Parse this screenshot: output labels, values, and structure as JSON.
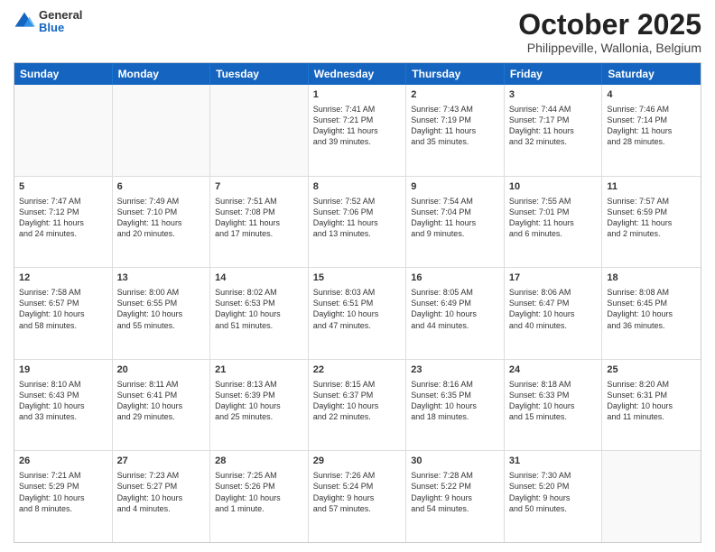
{
  "header": {
    "logo": {
      "general": "General",
      "blue": "Blue"
    },
    "title": "October 2025",
    "location": "Philippeville, Wallonia, Belgium"
  },
  "calendar": {
    "days": [
      "Sunday",
      "Monday",
      "Tuesday",
      "Wednesday",
      "Thursday",
      "Friday",
      "Saturday"
    ],
    "weeks": [
      [
        {
          "day": "",
          "content": ""
        },
        {
          "day": "",
          "content": ""
        },
        {
          "day": "",
          "content": ""
        },
        {
          "day": "1",
          "content": "Sunrise: 7:41 AM\nSunset: 7:21 PM\nDaylight: 11 hours\nand 39 minutes."
        },
        {
          "day": "2",
          "content": "Sunrise: 7:43 AM\nSunset: 7:19 PM\nDaylight: 11 hours\nand 35 minutes."
        },
        {
          "day": "3",
          "content": "Sunrise: 7:44 AM\nSunset: 7:17 PM\nDaylight: 11 hours\nand 32 minutes."
        },
        {
          "day": "4",
          "content": "Sunrise: 7:46 AM\nSunset: 7:14 PM\nDaylight: 11 hours\nand 28 minutes."
        }
      ],
      [
        {
          "day": "5",
          "content": "Sunrise: 7:47 AM\nSunset: 7:12 PM\nDaylight: 11 hours\nand 24 minutes."
        },
        {
          "day": "6",
          "content": "Sunrise: 7:49 AM\nSunset: 7:10 PM\nDaylight: 11 hours\nand 20 minutes."
        },
        {
          "day": "7",
          "content": "Sunrise: 7:51 AM\nSunset: 7:08 PM\nDaylight: 11 hours\nand 17 minutes."
        },
        {
          "day": "8",
          "content": "Sunrise: 7:52 AM\nSunset: 7:06 PM\nDaylight: 11 hours\nand 13 minutes."
        },
        {
          "day": "9",
          "content": "Sunrise: 7:54 AM\nSunset: 7:04 PM\nDaylight: 11 hours\nand 9 minutes."
        },
        {
          "day": "10",
          "content": "Sunrise: 7:55 AM\nSunset: 7:01 PM\nDaylight: 11 hours\nand 6 minutes."
        },
        {
          "day": "11",
          "content": "Sunrise: 7:57 AM\nSunset: 6:59 PM\nDaylight: 11 hours\nand 2 minutes."
        }
      ],
      [
        {
          "day": "12",
          "content": "Sunrise: 7:58 AM\nSunset: 6:57 PM\nDaylight: 10 hours\nand 58 minutes."
        },
        {
          "day": "13",
          "content": "Sunrise: 8:00 AM\nSunset: 6:55 PM\nDaylight: 10 hours\nand 55 minutes."
        },
        {
          "day": "14",
          "content": "Sunrise: 8:02 AM\nSunset: 6:53 PM\nDaylight: 10 hours\nand 51 minutes."
        },
        {
          "day": "15",
          "content": "Sunrise: 8:03 AM\nSunset: 6:51 PM\nDaylight: 10 hours\nand 47 minutes."
        },
        {
          "day": "16",
          "content": "Sunrise: 8:05 AM\nSunset: 6:49 PM\nDaylight: 10 hours\nand 44 minutes."
        },
        {
          "day": "17",
          "content": "Sunrise: 8:06 AM\nSunset: 6:47 PM\nDaylight: 10 hours\nand 40 minutes."
        },
        {
          "day": "18",
          "content": "Sunrise: 8:08 AM\nSunset: 6:45 PM\nDaylight: 10 hours\nand 36 minutes."
        }
      ],
      [
        {
          "day": "19",
          "content": "Sunrise: 8:10 AM\nSunset: 6:43 PM\nDaylight: 10 hours\nand 33 minutes."
        },
        {
          "day": "20",
          "content": "Sunrise: 8:11 AM\nSunset: 6:41 PM\nDaylight: 10 hours\nand 29 minutes."
        },
        {
          "day": "21",
          "content": "Sunrise: 8:13 AM\nSunset: 6:39 PM\nDaylight: 10 hours\nand 25 minutes."
        },
        {
          "day": "22",
          "content": "Sunrise: 8:15 AM\nSunset: 6:37 PM\nDaylight: 10 hours\nand 22 minutes."
        },
        {
          "day": "23",
          "content": "Sunrise: 8:16 AM\nSunset: 6:35 PM\nDaylight: 10 hours\nand 18 minutes."
        },
        {
          "day": "24",
          "content": "Sunrise: 8:18 AM\nSunset: 6:33 PM\nDaylight: 10 hours\nand 15 minutes."
        },
        {
          "day": "25",
          "content": "Sunrise: 8:20 AM\nSunset: 6:31 PM\nDaylight: 10 hours\nand 11 minutes."
        }
      ],
      [
        {
          "day": "26",
          "content": "Sunrise: 7:21 AM\nSunset: 5:29 PM\nDaylight: 10 hours\nand 8 minutes."
        },
        {
          "day": "27",
          "content": "Sunrise: 7:23 AM\nSunset: 5:27 PM\nDaylight: 10 hours\nand 4 minutes."
        },
        {
          "day": "28",
          "content": "Sunrise: 7:25 AM\nSunset: 5:26 PM\nDaylight: 10 hours\nand 1 minute."
        },
        {
          "day": "29",
          "content": "Sunrise: 7:26 AM\nSunset: 5:24 PM\nDaylight: 9 hours\nand 57 minutes."
        },
        {
          "day": "30",
          "content": "Sunrise: 7:28 AM\nSunset: 5:22 PM\nDaylight: 9 hours\nand 54 minutes."
        },
        {
          "day": "31",
          "content": "Sunrise: 7:30 AM\nSunset: 5:20 PM\nDaylight: 9 hours\nand 50 minutes."
        },
        {
          "day": "",
          "content": ""
        }
      ]
    ]
  }
}
